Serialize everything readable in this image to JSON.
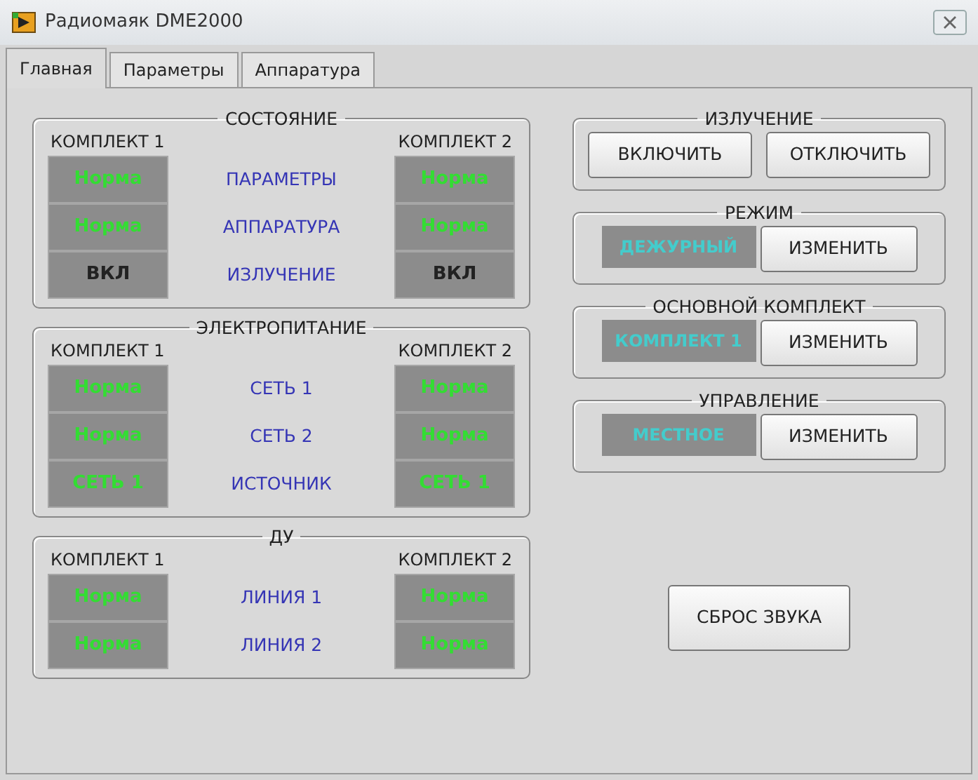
{
  "window": {
    "title": "Радиомаяк DME2000"
  },
  "tabs": [
    {
      "label": "Главная",
      "selected": true
    },
    {
      "label": "Параметры",
      "selected": false
    },
    {
      "label": "Аппаратура",
      "selected": false
    }
  ],
  "left_groups": [
    {
      "title": "СОСТОЯНИЕ",
      "headers": [
        "КОМПЛЕКТ 1",
        "КОМПЛЕКТ 2"
      ],
      "rows": [
        {
          "label": "ПАРАМЕТРЫ",
          "set_1": {
            "text": "Норма",
            "kind": "normal"
          },
          "set_2": {
            "text": "Норма",
            "kind": "normal"
          }
        },
        {
          "label": "АППАРАТУРА",
          "set_1": {
            "text": "Норма",
            "kind": "normal"
          },
          "set_2": {
            "text": "Норма",
            "kind": "normal"
          }
        },
        {
          "label": "ИЗЛУЧЕНИЕ",
          "set_1": {
            "text": "ВКЛ",
            "kind": "on"
          },
          "set_2": {
            "text": "ВКЛ",
            "kind": "on"
          }
        }
      ]
    },
    {
      "title": "ЭЛЕКТРОПИТАНИЕ",
      "headers": [
        "КОМПЛЕКТ 1",
        "КОМПЛЕКТ 2"
      ],
      "rows": [
        {
          "label": "СЕТЬ 1",
          "set_1": {
            "text": "Норма",
            "kind": "normal"
          },
          "set_2": {
            "text": "Норма",
            "kind": "normal"
          }
        },
        {
          "label": "СЕТЬ 2",
          "set_1": {
            "text": "Норма",
            "kind": "normal"
          },
          "set_2": {
            "text": "Норма",
            "kind": "normal"
          }
        },
        {
          "label": "ИСТОЧНИК",
          "set_1": {
            "text": "СЕТЬ 1",
            "kind": "normal"
          },
          "set_2": {
            "text": "СЕТЬ 1",
            "kind": "normal"
          }
        }
      ]
    },
    {
      "title": "ДУ",
      "headers": [
        "КОМПЛЕКТ 1",
        "КОМПЛЕКТ 2"
      ],
      "rows": [
        {
          "label": "ЛИНИЯ 1",
          "set_1": {
            "text": "Норма",
            "kind": "normal"
          },
          "set_2": {
            "text": "Норма",
            "kind": "normal"
          }
        },
        {
          "label": "ЛИНИЯ 2",
          "set_1": {
            "text": "Норма",
            "kind": "normal"
          },
          "set_2": {
            "text": "Норма",
            "kind": "normal"
          }
        }
      ]
    }
  ],
  "right_groups": [
    {
      "title": "ИЗЛУЧЕНИЕ",
      "buttons": [
        "ВКЛЮЧИТЬ",
        "ОТКЛЮЧИТЬ"
      ]
    },
    {
      "title": "РЕЖИМ",
      "display": "ДЕЖУРНЫЙ",
      "buttons": [
        "ИЗМЕНИТЬ"
      ]
    },
    {
      "title": "ОСНОВНОЙ КОМПЛЕКТ",
      "display": "КОМПЛЕКТ 1",
      "buttons": [
        "ИЗМЕНИТЬ"
      ]
    },
    {
      "title": "УПРАВЛЕНИЕ",
      "display": "МЕСТНОЕ",
      "buttons": [
        "ИЗМЕНИТЬ"
      ]
    }
  ],
  "reset_button": "СБРОС ЗВУКА"
}
